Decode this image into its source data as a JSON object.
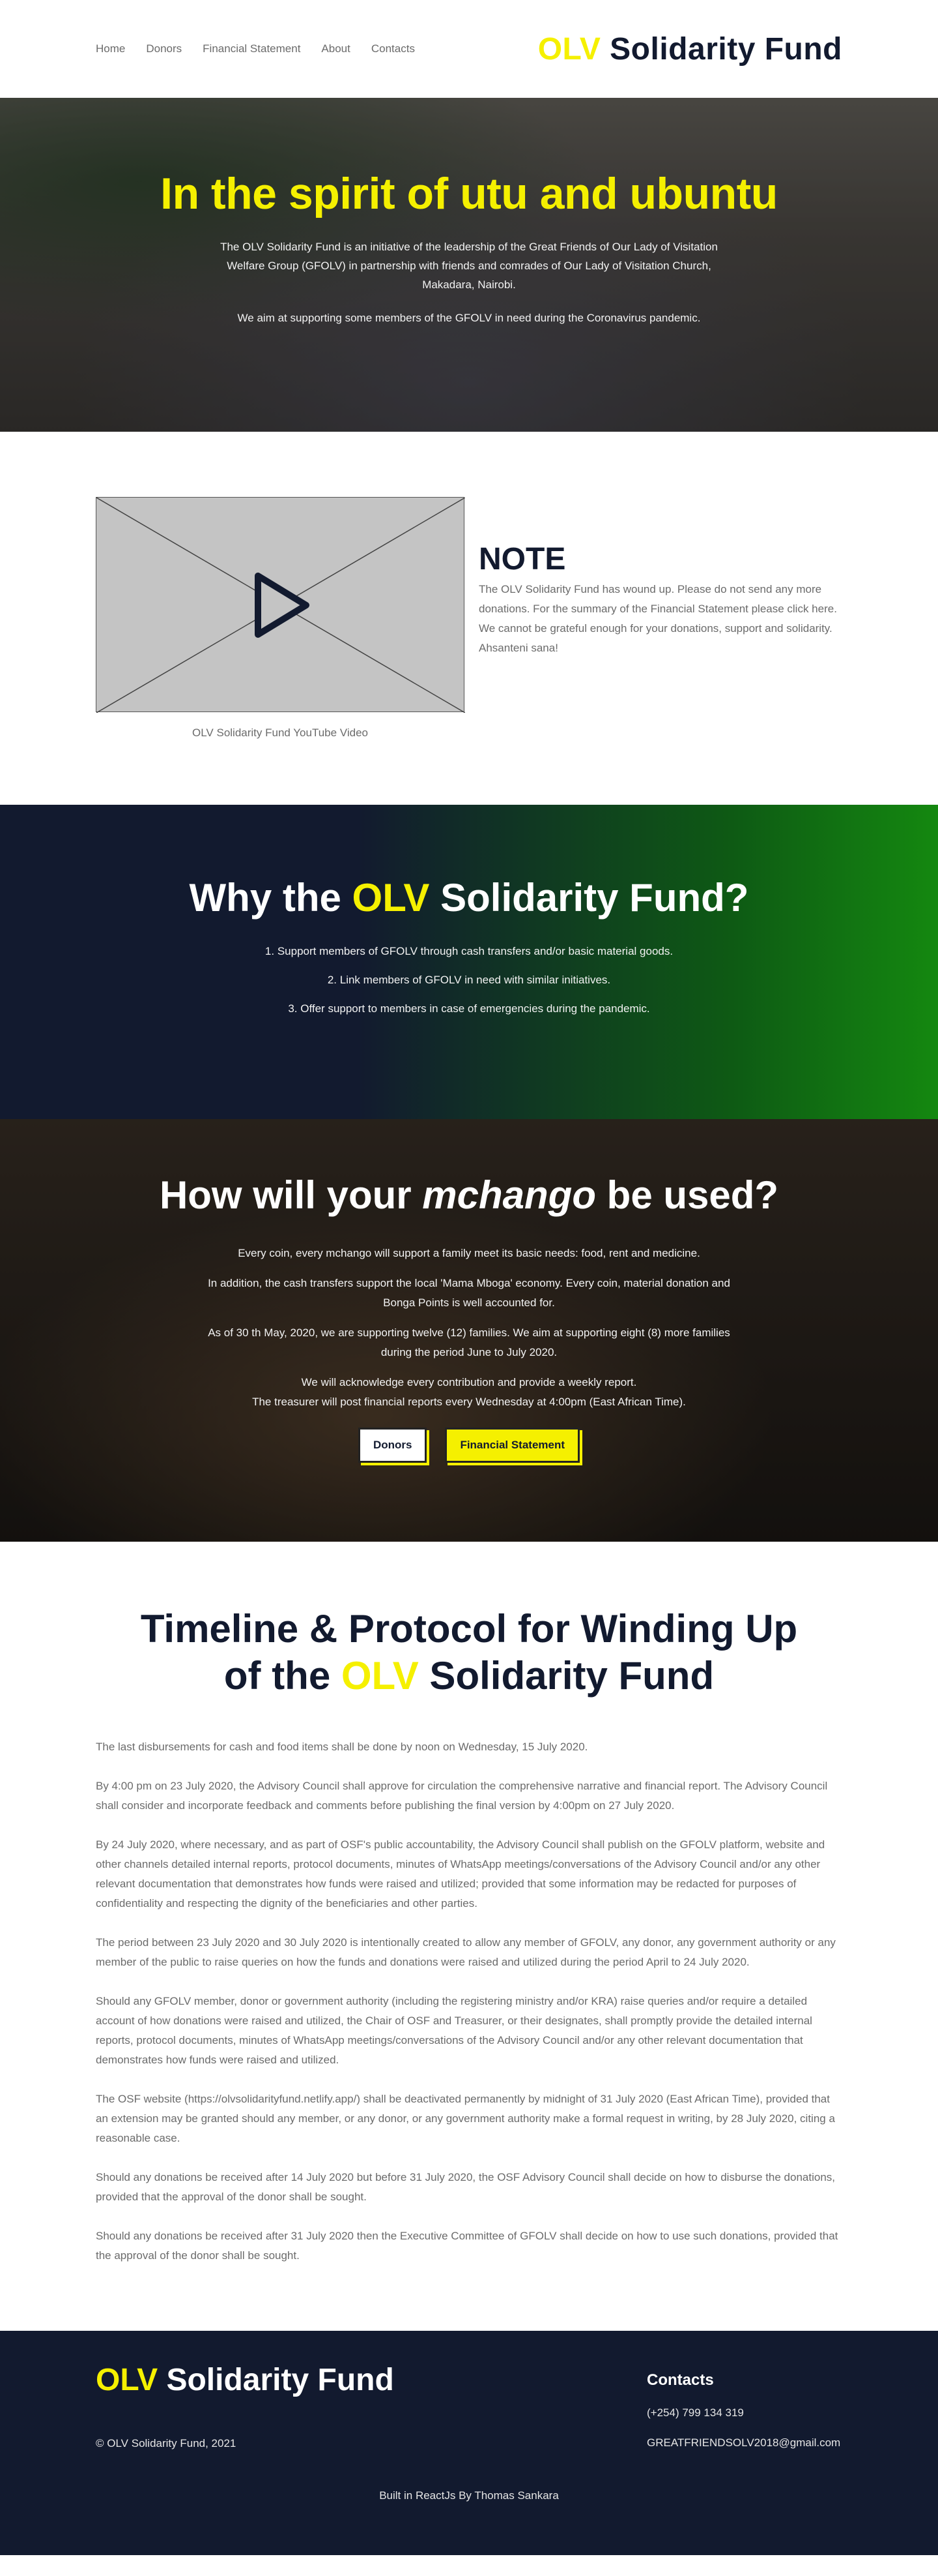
{
  "nav": {
    "items": [
      "Home",
      "Donors",
      "Financial Statement",
      "About",
      "Contacts"
    ]
  },
  "brand": {
    "accent": "OLV",
    "rest": " Solidarity Fund"
  },
  "hero": {
    "title": "In the spirit of utu and ubuntu",
    "paragraph1": "The OLV Solidarity Fund is an initiative of the leadership of the Great Friends of Our Lady of Visitation Welfare Group (GFOLV) in partnership with friends and comrades of Our Lady of Visitation Church, Makadara, Nairobi.",
    "paragraph2": "We aim at supporting some members of the GFOLV in need during the Coronavirus pandemic."
  },
  "note": {
    "title": "NOTE",
    "text": "The OLV Solidarity Fund has wound up. Please do not send any more donations. For the summary of the Financial Statement please click here. We cannot be grateful enough for your donations, support and solidarity. Ahsanteni sana!",
    "video_caption": "OLV Solidarity Fund YouTube Video"
  },
  "why": {
    "title_pre": "Why the ",
    "title_accent": "OLV",
    "title_post": " Solidarity Fund?",
    "items": [
      "1. Support members of GFOLV through cash transfers and/or basic material goods.",
      "2. Link members of GFOLV in need with similar initiatives.",
      "3. Offer support to members in case of emergencies during the pandemic."
    ]
  },
  "how": {
    "title_pre": "How will your ",
    "title_em": "mchango",
    "title_post": " be used?",
    "paragraphs": [
      "Every coin, every mchango will support a family meet its basic needs: food, rent and medicine.",
      "In addition, the cash transfers support the local 'Mama Mboga' economy. Every coin, material donation and Bonga Points is well accounted for.",
      "As of 30 th May, 2020, we are supporting twelve (12) families. We aim at supporting eight (8) more families during the period June to July 2020.",
      "We will acknowledge every contribution and provide a weekly report.",
      "The treasurer will post financial reports every Wednesday at 4:00pm (East African Time)."
    ],
    "btn_donors": "Donors",
    "btn_financial": "Financial Statement"
  },
  "timeline": {
    "title_line1": "Timeline & Protocol for Winding Up",
    "title_pre": "of the ",
    "title_accent": "OLV",
    "title_post": " Solidarity Fund",
    "items": [
      "The last disbursements for cash and food items shall be done by noon on Wednesday, 15 July 2020.",
      "By 4:00 pm on 23 July 2020, the Advisory Council shall approve for circulation the comprehensive narrative and financial report. The Advisory Council shall consider and incorporate feedback and comments before publishing the final version by 4:00pm on 27 July 2020.",
      "By 24 July 2020, where necessary, and as part of OSF's public accountability, the Advisory Council shall publish on the GFOLV platform, website and other channels detailed internal reports, protocol documents, minutes of WhatsApp meetings/conversations of the Advisory Council and/or any other relevant documentation that demonstrates how funds were raised and utilized; provided that some information may be redacted for purposes of confidentiality and respecting the dignity of the beneficiaries and other parties.",
      "The period between 23 July 2020 and 30 July 2020 is intentionally created to allow any member of GFOLV, any donor, any government authority or any member of the public to raise queries on how the funds and donations were raised and utilized during the period April to 24 July 2020.",
      "Should any GFOLV member, donor or government authority (including the registering ministry and/or KRA) raise queries and/or require a detailed account of how donations were raised and utilized, the Chair of OSF and Treasurer, or their designates, shall promptly provide the detailed internal reports, protocol documents, minutes of WhatsApp meetings/conversations of the Advisory Council and/or any other relevant documentation that demonstrates how funds were raised and utilized.",
      "The OSF website (https://olvsolidarityfund.netlify.app/) shall be deactivated permanently by midnight of 31 July 2020 (East African Time), provided that an extension may be granted should any member, or any donor, or any government authority make a formal request in writing, by 28 July 2020, citing a reasonable case.",
      "Should any donations be received after 14 July 2020 but before 31 July 2020, the OSF Advisory Council shall decide on how to disburse the donations, provided that the approval of the donor shall be sought.",
      "Should any donations be received after 31 July 2020 then the Executive Committee of GFOLV shall decide on how to use such donations, provided that the approval of the donor shall be sought."
    ]
  },
  "footer": {
    "copyright": "© OLV Solidarity Fund, 2021",
    "contacts_title": "Contacts",
    "phone": "(+254) 799 134 319",
    "email": "GREATFRIENDSOLV2018@gmail.com",
    "credit": "Built in ReactJs By Thomas Sankara"
  },
  "colors": {
    "accent": "#f5f000",
    "navy": "#121a2f",
    "green": "#148810"
  }
}
